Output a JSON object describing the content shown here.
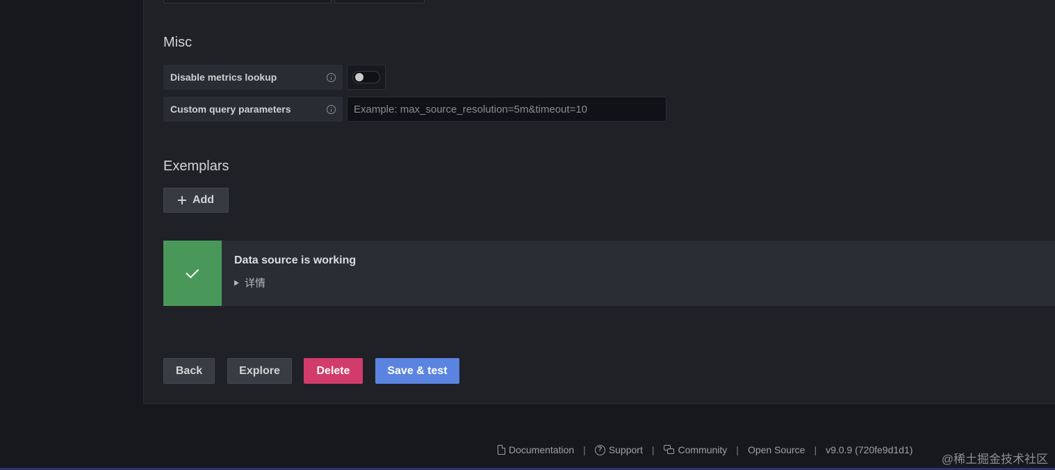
{
  "misc": {
    "title": "Misc",
    "disable_metrics_lookup": {
      "label": "Disable metrics lookup",
      "enabled": false
    },
    "custom_query_parameters": {
      "label": "Custom query parameters",
      "value": "",
      "placeholder": "Example: max_source_resolution=5m&timeout=10"
    }
  },
  "exemplars": {
    "title": "Exemplars",
    "add_label": "Add"
  },
  "alert": {
    "title": "Data source is working",
    "details_label": "详情",
    "status_color": "#4a9859"
  },
  "actions": {
    "back": "Back",
    "explore": "Explore",
    "delete": "Delete",
    "save_test": "Save & test"
  },
  "footer": {
    "documentation": "Documentation",
    "support": "Support",
    "community": "Community",
    "open_source": "Open Source",
    "version": "v9.0.9 (720fe9d1d1)",
    "separator": "|"
  },
  "watermark": "@稀土掘金技术社区",
  "colors": {
    "delete": "#d13c6a",
    "primary": "#5b84e0"
  }
}
